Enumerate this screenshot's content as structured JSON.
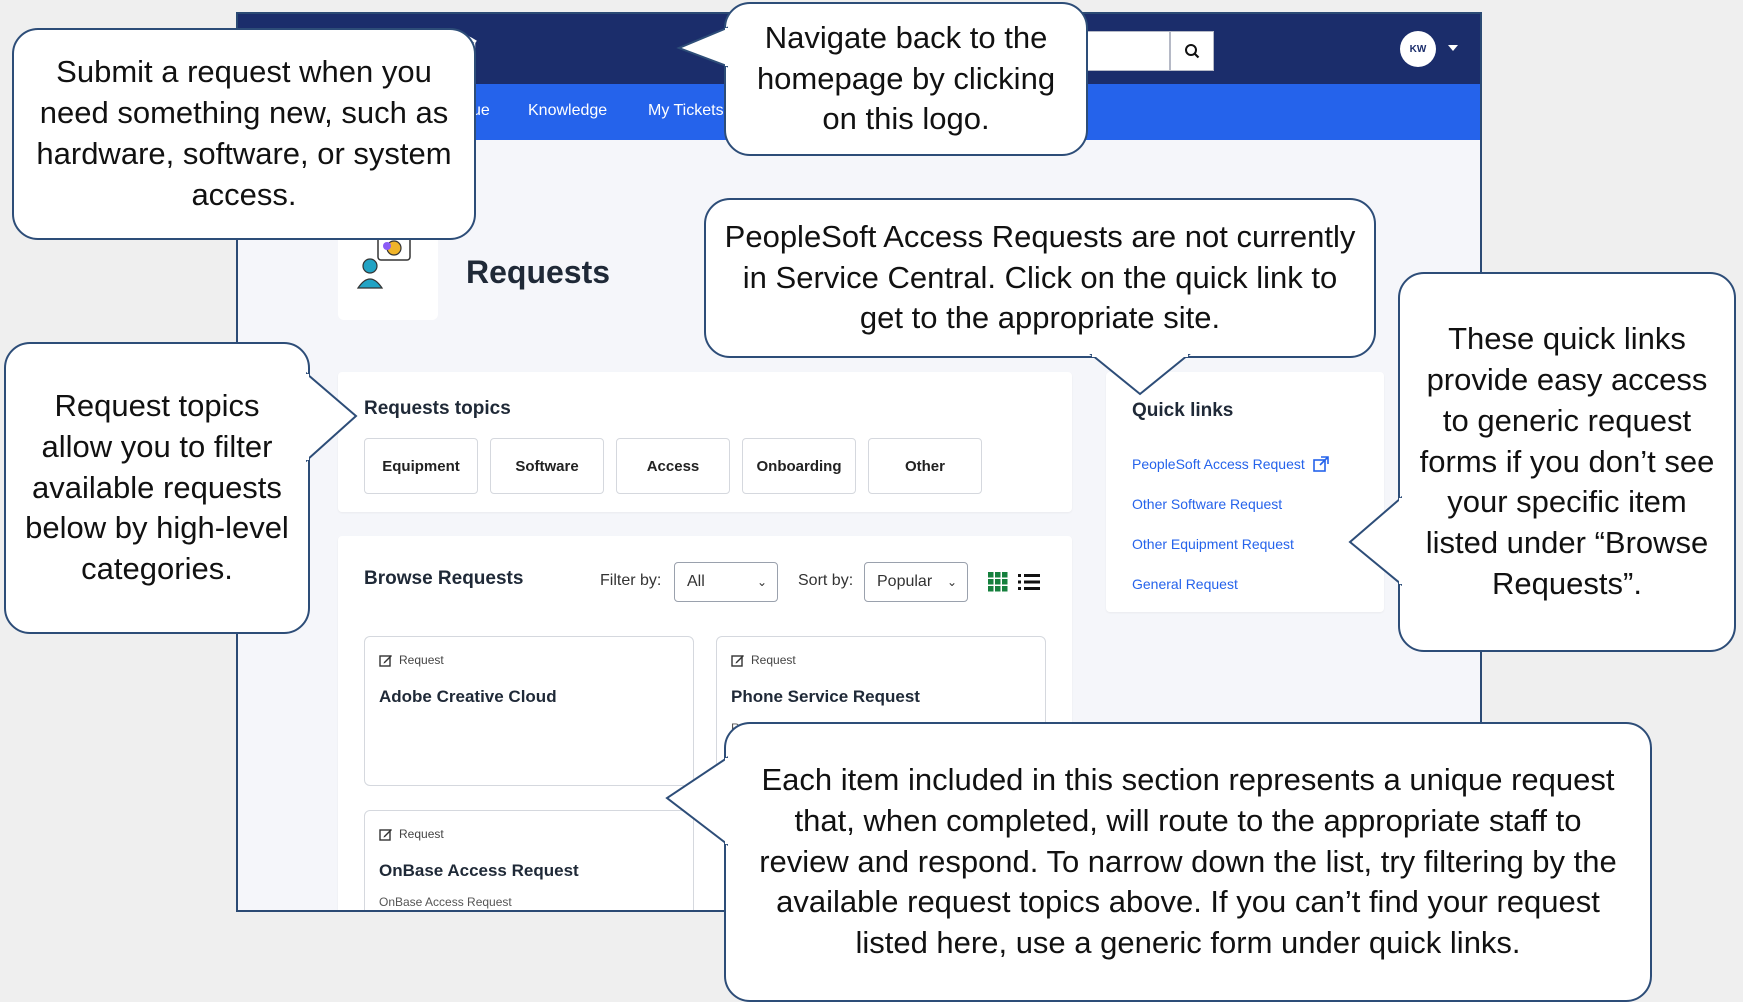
{
  "header": {
    "search_icon": "search-icon",
    "avatar_initials": "KW"
  },
  "nav": {
    "items": [
      "ue",
      "Knowledge",
      "My Tickets"
    ]
  },
  "page": {
    "title": "Requests"
  },
  "request_topics": {
    "title": "Requests topics",
    "buttons": [
      "Equipment",
      "Software",
      "Access",
      "Onboarding",
      "Other"
    ]
  },
  "browse": {
    "title": "Browse Requests",
    "filter_label": "Filter by:",
    "filter_value": "All",
    "sort_label": "Sort by:",
    "sort_value": "Popular",
    "accent_color": "#15803d",
    "cards": [
      {
        "tag": "Request",
        "name": "Adobe Creative Cloud",
        "desc": ""
      },
      {
        "tag": "Request",
        "name": "Phone Service Request",
        "desc": "R"
      },
      {
        "tag": "Request",
        "name": "OnBase Access Request",
        "desc": "OnBase Access Request"
      }
    ]
  },
  "quick_links": {
    "title": "Quick links",
    "links": [
      "PeopleSoft Access Request",
      "Other Software Request",
      "Other Equipment Request",
      "General Request"
    ]
  },
  "callouts": {
    "submit": "Submit a request when you need something new, such as hardware, software, or system access.",
    "logo": "Navigate back to the homepage by clicking on this logo.",
    "peoplesoft": "PeopleSoft Access Requests are not currently in Service Central. Click on the quick link to get to the appropriate site.",
    "topics": "Request topics allow you to filter available requests below by high-level categories.",
    "quicklinks": "These quick links provide easy access to generic request forms if you don’t see your specific item listed under “Browse Requests”.",
    "items": "Each item included in this section represents a unique request that, when completed, will route to the appropriate staff to review and respond. To narrow down the list, try filtering by the available request topics above. If you can’t find your request listed here, use a generic form under quick links."
  },
  "colors": {
    "topbar": "#1b2d6b",
    "navbar": "#2563eb",
    "link": "#2563eb",
    "callout_border": "#2d4d78"
  }
}
